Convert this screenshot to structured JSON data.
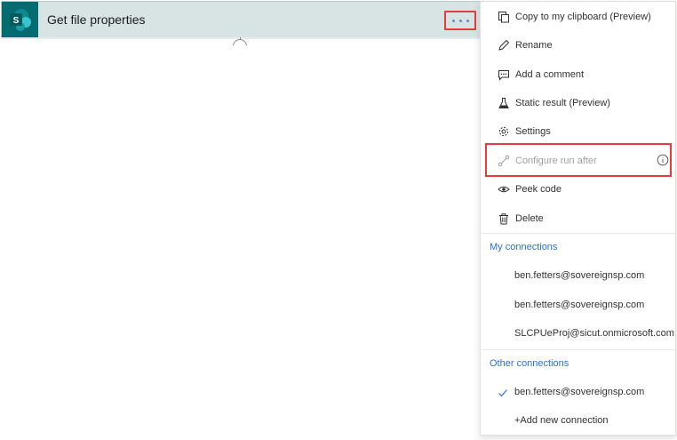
{
  "action": {
    "title": "Get file properties",
    "icon": "sharepoint-icon",
    "more_label": "..."
  },
  "menu": {
    "items": [
      {
        "label": "Copy to my clipboard (Preview)",
        "icon": "copy-icon"
      },
      {
        "label": "Rename",
        "icon": "pencil-icon"
      },
      {
        "label": "Add a comment",
        "icon": "comment-icon"
      },
      {
        "label": "Static result (Preview)",
        "icon": "beaker-icon"
      },
      {
        "label": "Settings",
        "icon": "gear-icon"
      },
      {
        "label": "Configure run after",
        "icon": "link-icon",
        "disabled": true
      },
      {
        "label": "Peek code",
        "icon": "eye-icon"
      },
      {
        "label": "Delete",
        "icon": "trash-icon"
      }
    ],
    "my_connections": {
      "header": "My connections",
      "items": [
        "ben.fetters@sovereignsp.com",
        "ben.fetters@sovereignsp.com",
        "SLCPUeProj@sicut.onmicrosoft.com"
      ]
    },
    "other_connections": {
      "header": "Other connections",
      "items": [
        {
          "label": "ben.fetters@sovereignsp.com",
          "selected": true
        },
        {
          "label": "+Add new connection",
          "selected": false
        }
      ]
    }
  },
  "colors": {
    "card_bg": "#d8e4e4",
    "sharepoint": "#036c70",
    "accent_link": "#2b6fd6",
    "highlight": "#e8393d"
  }
}
